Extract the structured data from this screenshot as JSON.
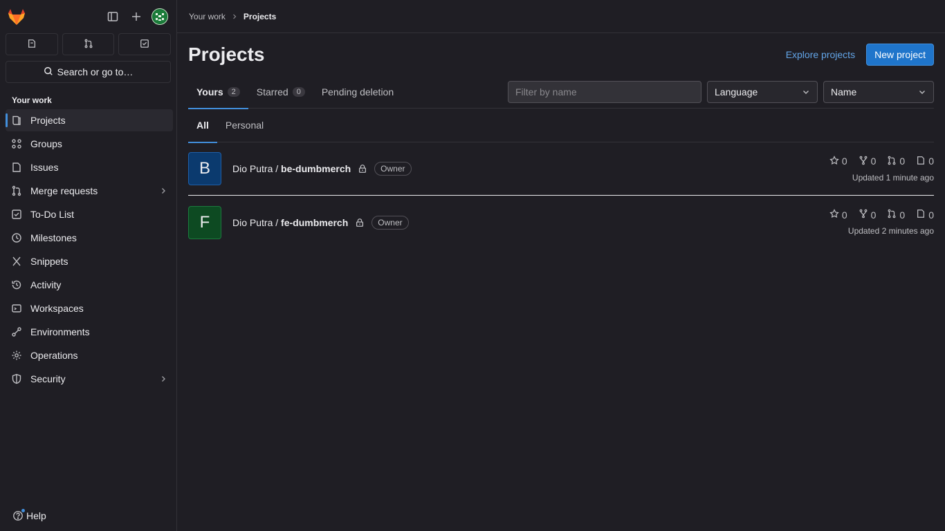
{
  "sidebar": {
    "section_title": "Your work",
    "search_label": "Search or go to…",
    "items": [
      {
        "label": "Projects",
        "icon": "project-icon"
      },
      {
        "label": "Groups",
        "icon": "group-icon"
      },
      {
        "label": "Issues",
        "icon": "issues-icon"
      },
      {
        "label": "Merge requests",
        "icon": "merge-request-icon"
      },
      {
        "label": "To-Do List",
        "icon": "todo-icon"
      },
      {
        "label": "Milestones",
        "icon": "clock-icon"
      },
      {
        "label": "Snippets",
        "icon": "snippet-icon"
      },
      {
        "label": "Activity",
        "icon": "history-icon"
      },
      {
        "label": "Workspaces",
        "icon": "workspace-icon"
      },
      {
        "label": "Environments",
        "icon": "environment-icon"
      },
      {
        "label": "Operations",
        "icon": "cloud-gear-icon"
      },
      {
        "label": "Security",
        "icon": "shield-icon"
      }
    ],
    "help_label": "Help"
  },
  "breadcrumb": {
    "parent": "Your work",
    "current": "Projects"
  },
  "page": {
    "title": "Projects",
    "explore_label": "Explore projects",
    "new_project_label": "New project"
  },
  "tabs": [
    {
      "label": "Yours",
      "count": "2"
    },
    {
      "label": "Starred",
      "count": "0"
    },
    {
      "label": "Pending deletion",
      "count": ""
    }
  ],
  "filters": {
    "name_placeholder": "Filter by name",
    "language": "Language",
    "sort": "Name"
  },
  "subtabs": [
    "All",
    "Personal"
  ],
  "projects": [
    {
      "initial": "B",
      "namespace": "Dio Putra / ",
      "name": "be-dumbmerch",
      "role": "Owner",
      "stars": "0",
      "forks": "0",
      "merge_requests": "0",
      "issues": "0",
      "updated": "Updated 1 minute ago",
      "color": "#0b3a6e"
    },
    {
      "initial": "F",
      "namespace": "Dio Putra / ",
      "name": "fe-dumbmerch",
      "role": "Owner",
      "stars": "0",
      "forks": "0",
      "merge_requests": "0",
      "issues": "0",
      "updated": "Updated 2 minutes ago",
      "color": "#0d4a22"
    }
  ],
  "colors": {
    "accent": "#428fdc",
    "primary_button": "#1f75cb",
    "link": "#63a6e9",
    "background": "#1f1e24"
  }
}
